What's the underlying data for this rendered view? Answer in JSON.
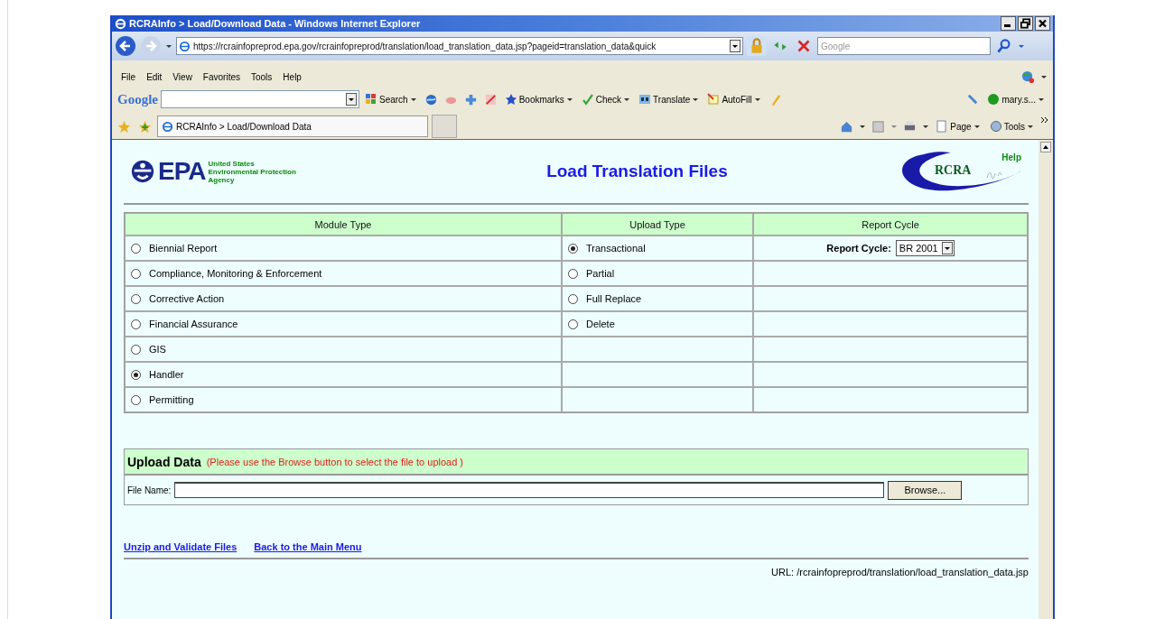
{
  "window": {
    "title": "RCRAInfo > Load/Download Data - Windows Internet Explorer"
  },
  "address_bar": {
    "url": "https://rcrainfopreprod.epa.gov/rcrainfopreprod/translation/load_translation_data.jsp?pageid=translation_data&quick"
  },
  "search_box": {
    "placeholder": "Google"
  },
  "menu": [
    "File",
    "Edit",
    "View",
    "Favorites",
    "Tools",
    "Help"
  ],
  "google_toolbar": {
    "logo": "Google",
    "items": [
      {
        "kind": "search",
        "label": "Search"
      },
      {
        "kind": "bookmarks",
        "label": "Bookmarks"
      },
      {
        "kind": "check",
        "label": "Check"
      },
      {
        "kind": "translate",
        "label": "Translate"
      },
      {
        "kind": "autofill",
        "label": "AutoFill"
      },
      {
        "kind": "user",
        "label": "mary.s..."
      }
    ]
  },
  "tabs": [
    {
      "label": "RCRAInfo > Load/Download Data",
      "selected": true
    }
  ],
  "command_bar": [
    {
      "kind": "page",
      "label": "Page"
    },
    {
      "kind": "tools",
      "label": "Tools"
    }
  ],
  "page": {
    "epa": {
      "mark": "EPA",
      "agency": [
        "United States",
        "Environmental Protection",
        "Agency"
      ]
    },
    "title": "Load Translation Files",
    "rcra": {
      "mark": "RCRA",
      "help": "Help"
    },
    "columns": [
      "Module Type",
      "Upload Type",
      "Report Cycle"
    ],
    "module_types": [
      {
        "label": "Biennial Report",
        "selected": false
      },
      {
        "label": "Compliance, Monitoring & Enforcement",
        "selected": false
      },
      {
        "label": "Corrective Action",
        "selected": false
      },
      {
        "label": "Financial Assurance",
        "selected": false
      },
      {
        "label": "GIS",
        "selected": false
      },
      {
        "label": "Handler",
        "selected": true
      },
      {
        "label": "Permitting",
        "selected": false
      }
    ],
    "upload_types": [
      {
        "label": "Transactional",
        "selected": true
      },
      {
        "label": "Partial",
        "selected": false
      },
      {
        "label": "Full Replace",
        "selected": false
      },
      {
        "label": "Delete",
        "selected": false
      }
    ],
    "report_cycle": {
      "label": "Report Cycle:",
      "value": "BR 2001"
    },
    "upload": {
      "title": "Upload Data",
      "hint": "(Please use the Browse button to select the file to upload )",
      "file_label": "File Name:",
      "browse": "Browse..."
    },
    "links": [
      "Unzip and Validate Files",
      "Back to the Main Menu"
    ],
    "url": "URL: /rcrainfopreprod/translation/load_translation_data.jsp"
  }
}
